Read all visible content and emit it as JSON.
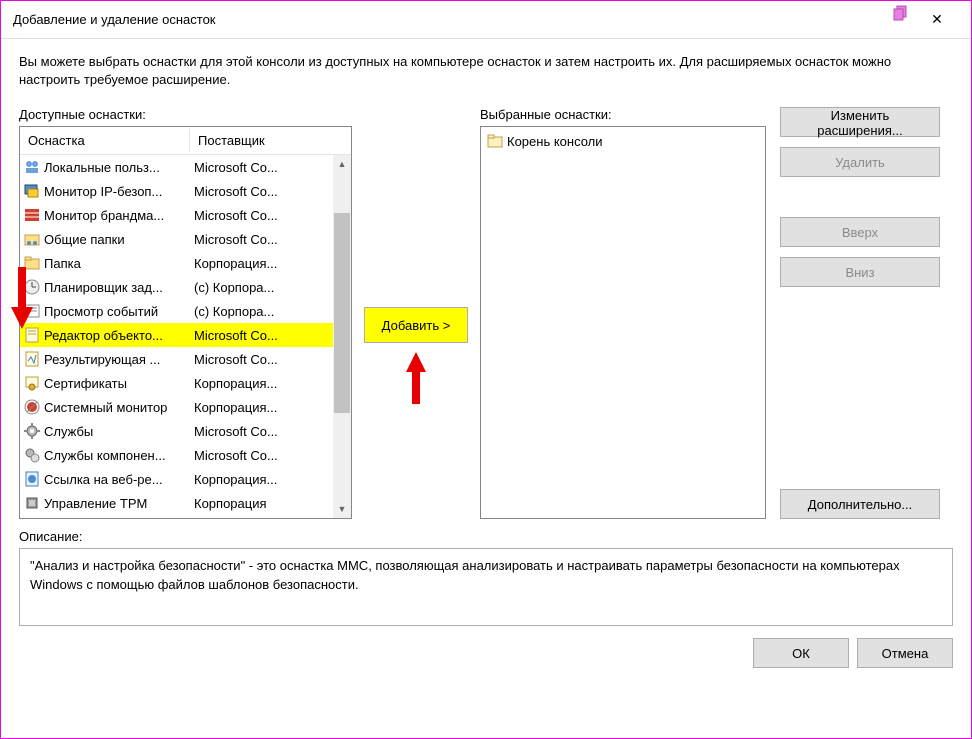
{
  "window": {
    "title": "Добавление и удаление оснасток",
    "close": "✕"
  },
  "intro": "Вы можете выбрать оснастки для этой консоли из доступных на компьютере оснасток и затем настроить их. Для расширяемых оснасток можно настроить требуемое расширение.",
  "available": {
    "label": "Доступные оснастки:",
    "col1": "Оснастка",
    "col2": "Поставщик",
    "rows": [
      {
        "name": "Локальные польз...",
        "vendor": "Microsoft Co...",
        "icon": "users"
      },
      {
        "name": "Монитор IP-безоп...",
        "vendor": "Microsoft Co...",
        "icon": "monitor-ip"
      },
      {
        "name": "Монитор брандма...",
        "vendor": "Microsoft Co...",
        "icon": "firewall"
      },
      {
        "name": "Общие папки",
        "vendor": "Microsoft Co...",
        "icon": "shared-folders"
      },
      {
        "name": "Папка",
        "vendor": "Корпорация...",
        "icon": "folder"
      },
      {
        "name": "Планировщик зад...",
        "vendor": "(c) Корпора...",
        "icon": "scheduler"
      },
      {
        "name": "Просмотр событий",
        "vendor": "(c) Корпора...",
        "icon": "event-viewer"
      },
      {
        "name": "Редактор объекто...",
        "vendor": "Microsoft Co...",
        "icon": "gpo-editor",
        "selected": true
      },
      {
        "name": "Результирующая ...",
        "vendor": "Microsoft Co...",
        "icon": "rsop"
      },
      {
        "name": "Сертификаты",
        "vendor": "Корпорация...",
        "icon": "certificates"
      },
      {
        "name": "Системный монитор",
        "vendor": "Корпорация...",
        "icon": "perfmon"
      },
      {
        "name": "Службы",
        "vendor": "Microsoft Co...",
        "icon": "services"
      },
      {
        "name": "Службы компонен...",
        "vendor": "Microsoft Co...",
        "icon": "component-services"
      },
      {
        "name": "Ссылка на веб-ре...",
        "vendor": "Корпорация...",
        "icon": "web-link"
      },
      {
        "name": "Управление TPM",
        "vendor": "Корпорация",
        "icon": "tpm"
      }
    ]
  },
  "add_button": "Добавить >",
  "selected": {
    "label": "Выбранные оснастки:",
    "items": [
      {
        "name": "Корень консоли",
        "icon": "folder"
      }
    ]
  },
  "side_buttons": {
    "edit_ext": "Изменить расширения...",
    "remove": "Удалить",
    "up": "Вверх",
    "down": "Вниз",
    "advanced": "Дополнительно..."
  },
  "description": {
    "label": "Описание:",
    "text": "\"Анализ и настройка безопасности\" - это оснастка MMC, позволяющая анализировать и настраивать параметры безопасности на компьютерах Windows с помощью файлов шаблонов безопасности."
  },
  "buttons": {
    "ok": "ОК",
    "cancel": "Отмена"
  }
}
